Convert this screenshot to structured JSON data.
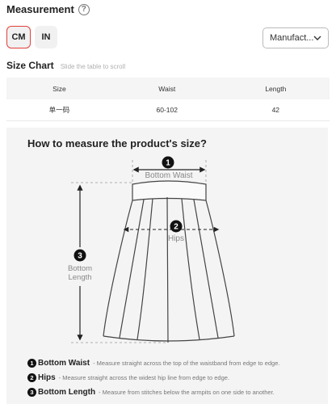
{
  "measurement": {
    "title": "Measurement",
    "help_icon": "question-circle-icon",
    "units": [
      "CM",
      "IN"
    ],
    "selected_unit": "CM",
    "source_select": "Manufact..."
  },
  "size_chart": {
    "title": "Size Chart",
    "hint": "Slide the table to scroll",
    "headers": [
      "Size",
      "Waist",
      "Length"
    ],
    "rows": [
      [
        "单一码",
        "60-102",
        "42"
      ]
    ]
  },
  "guide": {
    "title": "How to measure the product's size?",
    "diagram_labels": {
      "one": "1",
      "two": "2",
      "three": "3",
      "bottom_waist": "Bottom Waist",
      "hips": "Hips",
      "bottom": "Bottom",
      "length": "Length"
    },
    "items": [
      {
        "num": "1",
        "name": "Bottom Waist",
        "desc": "- Measure straight across the top of the waistband from edge to edge."
      },
      {
        "num": "2",
        "name": "Hips",
        "desc": "- Measure straight across the widest hip line from edge to edge."
      },
      {
        "num": "3",
        "name": "Bottom Length",
        "desc": "- Measure from stitches below the armpits on one side to another."
      }
    ]
  },
  "colors": {
    "accent": "#e0403c",
    "panel": "#f4f4f4"
  }
}
